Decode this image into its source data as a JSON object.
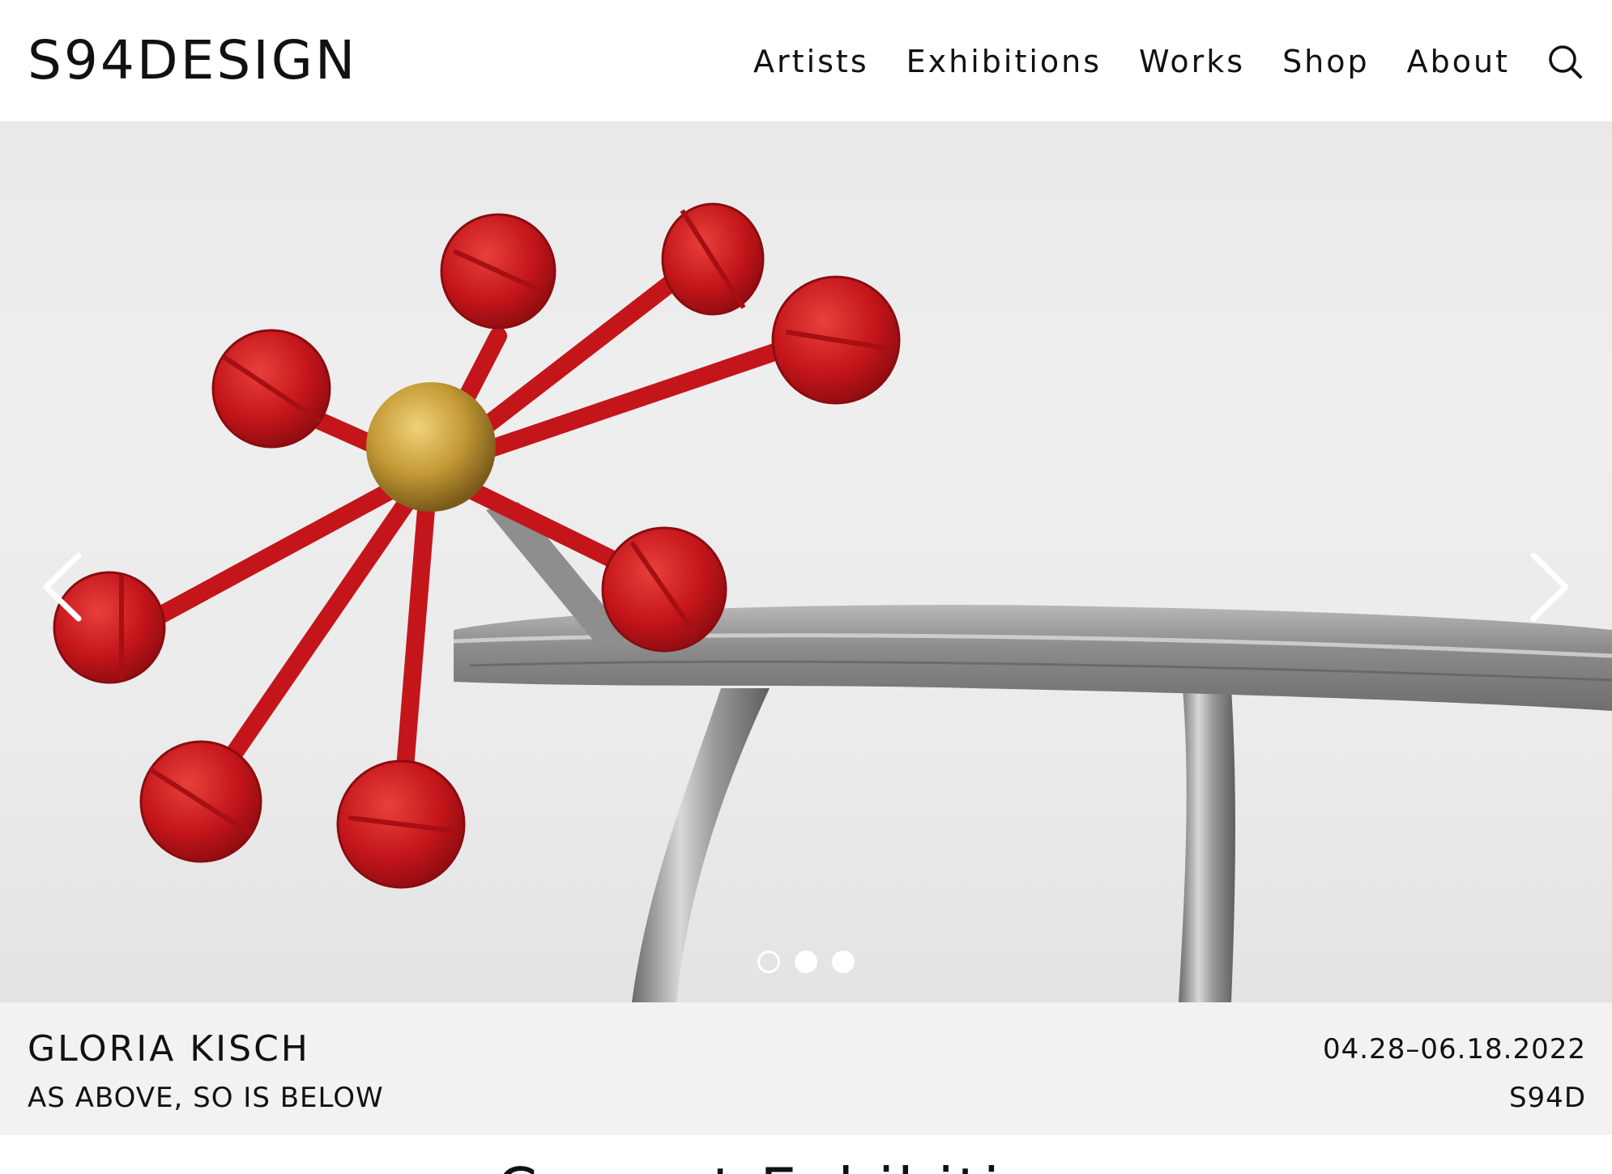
{
  "header": {
    "logo": "S94DESIGN",
    "nav": [
      "Artists",
      "Exhibitions",
      "Works",
      "Shop",
      "About"
    ],
    "search_icon": "search-icon"
  },
  "hero": {
    "prev_icon": "chevron-left-icon",
    "next_icon": "chevron-right-icon",
    "slides_total": 3,
    "active_slide": 1,
    "colors": {
      "sculpture_red": "#c8171b",
      "sphere_gold": "#c9a23a",
      "steel": "#9a9a9a",
      "background": "#ececec"
    }
  },
  "caption": {
    "artist": "GLORIA KISCH",
    "title": "AS ABOVE, SO IS BELOW",
    "dates": "04.28–06.18.2022",
    "venue": "S94D"
  },
  "section": {
    "heading": "Current Exhibitions"
  }
}
